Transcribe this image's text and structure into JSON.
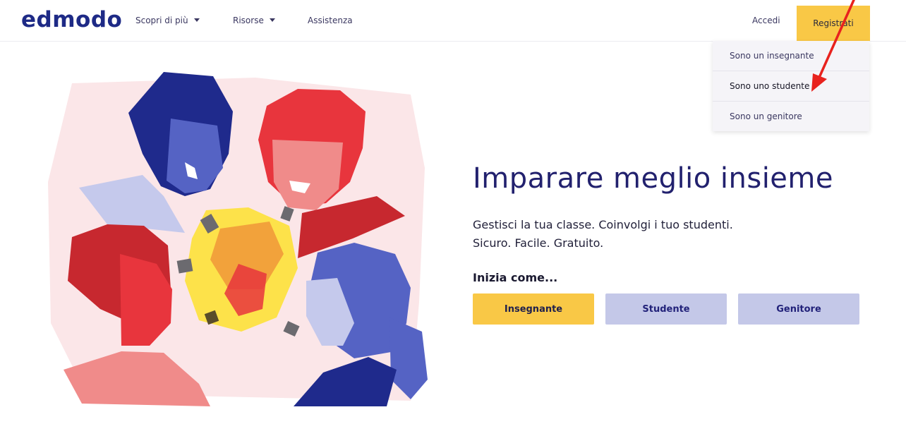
{
  "header": {
    "logo": "edmodo",
    "nav": [
      {
        "label": "Scopri di più",
        "has_caret": true
      },
      {
        "label": "Risorse",
        "has_caret": true
      },
      {
        "label": "Assistenza",
        "has_caret": false
      }
    ],
    "login_label": "Accedi",
    "register_label": "Registrati"
  },
  "dropdown": {
    "items": [
      {
        "label": "Sono un insegnante"
      },
      {
        "label": "Sono uno studente"
      },
      {
        "label": "Sono un genitore"
      }
    ]
  },
  "hero": {
    "title": "Imparare meglio insieme",
    "subtitle_line1": "Gestisci la tua classe. Coinvolgi i tuo studenti.",
    "subtitle_line2": "Sicuro. Facile. Gratuito.",
    "start_label": "Inizia come...",
    "buttons": [
      {
        "label": "Insegnante"
      },
      {
        "label": "Studente"
      },
      {
        "label": "Genitore"
      }
    ]
  },
  "colors": {
    "brand": "#1e2a86",
    "accent": "#f9c846",
    "button_secondary": "#c4c8e8",
    "annotation_arrow": "#e8221e"
  }
}
